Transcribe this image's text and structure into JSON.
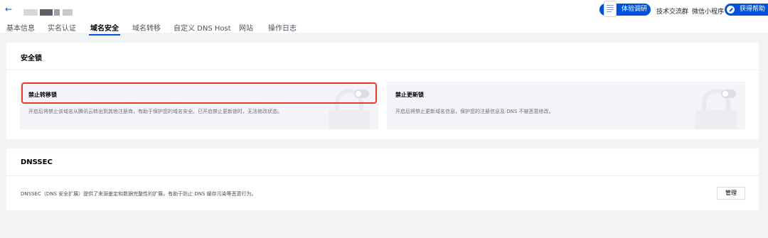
{
  "header": {
    "tabs": [
      {
        "label": "基本信息"
      },
      {
        "label": "实名认证"
      },
      {
        "label": "域名安全"
      },
      {
        "label": "域名转移"
      },
      {
        "label": "自定义 DNS Host"
      },
      {
        "label": "网站"
      },
      {
        "label": "操作日志"
      }
    ],
    "active_tab": "域名安全",
    "survey_label": "体验调研",
    "tech_group_label": "技术交流群",
    "mini_program_label": "微信小程序",
    "help_label": "获得帮助",
    "accent_color": "#0052d9"
  },
  "security_lock": {
    "title": "安全锁",
    "transfer_lock": {
      "label": "禁止转移锁",
      "enabled": false,
      "description": "开启后将禁止该域名从腾讯云转出到其他注册商，有助于保护您的域名安全。已开启禁止更新锁时，无法修改状态。",
      "highlight_color": "#e43d2c"
    },
    "update_lock": {
      "label": "禁止更新锁",
      "enabled": false,
      "description": "开启后将禁止更新域名信息，保护您的注册信息及 DNS 不被恶意修改。"
    }
  },
  "dnssec": {
    "title": "DNSSEC",
    "description": "DNSSEC（DNS 安全扩展）提供了来源鉴定和数据完整性的扩展，有助于防止 DNS 缓存污染等恶意行为。",
    "manage_label": "管理"
  }
}
